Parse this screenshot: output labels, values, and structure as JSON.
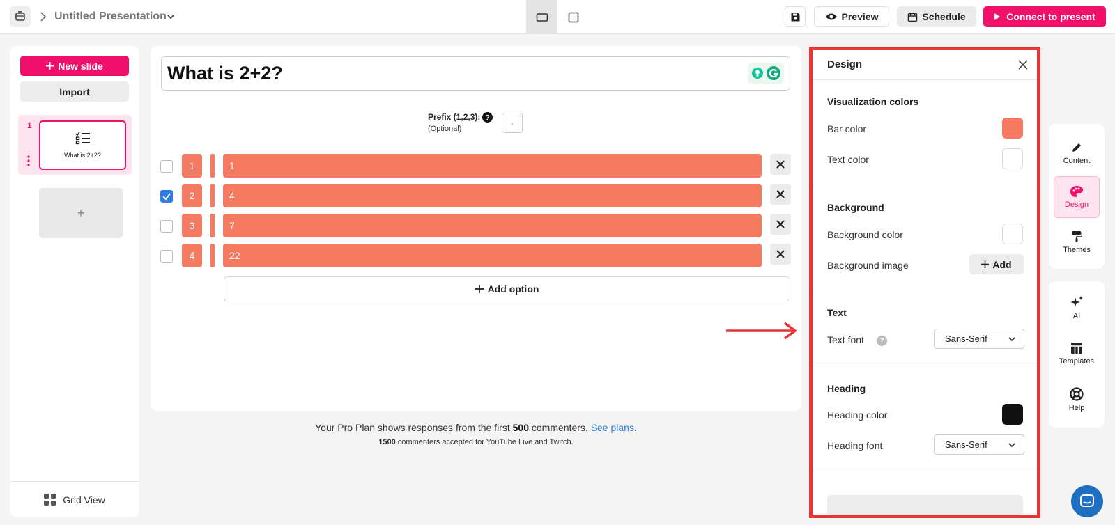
{
  "header": {
    "title": "Untitled Presentation",
    "preview_label": "Preview",
    "schedule_label": "Schedule",
    "connect_label": "Connect to present"
  },
  "sidebar": {
    "new_slide_label": "New slide",
    "import_label": "Import",
    "slides": [
      {
        "number": "1",
        "title": "What is 2+2?"
      }
    ],
    "add_slide_label": "+",
    "grid_view_label": "Grid View"
  },
  "editor": {
    "question": "What is 2+2?",
    "prefix_label": "Prefix (1,2,3):",
    "prefix_optional": "(Optional)",
    "prefix_value": "-",
    "options": [
      {
        "number": "1",
        "text": "1",
        "checked": false
      },
      {
        "number": "2",
        "text": "4",
        "checked": true
      },
      {
        "number": "3",
        "text": "7",
        "checked": false
      },
      {
        "number": "4",
        "text": "22",
        "checked": false
      }
    ],
    "add_option_label": "Add option",
    "option_color": "#f47b62"
  },
  "plan_note": {
    "prefix": "Your Pro Plan shows responses from the first ",
    "count": "500",
    "suffix": " commenters. ",
    "link": "See plans.",
    "sub_count": "1500",
    "sub_text": " commenters accepted for YouTube Live and Twitch."
  },
  "design_panel": {
    "title": "Design",
    "visualization_title": "Visualization colors",
    "bar_color_label": "Bar color",
    "bar_color": "#f47b62",
    "text_color_label": "Text color",
    "text_color": "#ffffff",
    "background_title": "Background",
    "background_color_label": "Background color",
    "background_color": "#ffffff",
    "background_image_label": "Background image",
    "add_label": "Add",
    "text_title": "Text",
    "text_font_label": "Text font",
    "text_font_value": "Sans-Serif",
    "heading_title": "Heading",
    "heading_color_label": "Heading color",
    "heading_color": "#111111",
    "heading_font_label": "Heading font",
    "heading_font_value": "Sans-Serif"
  },
  "rail": {
    "content_label": "Content",
    "design_label": "Design",
    "themes_label": "Themes",
    "ai_label": "AI",
    "templates_label": "Templates",
    "help_label": "Help"
  },
  "colors": {
    "brand": "#f0106a",
    "highlight_border": "#e53535",
    "link": "#2f7de1"
  }
}
